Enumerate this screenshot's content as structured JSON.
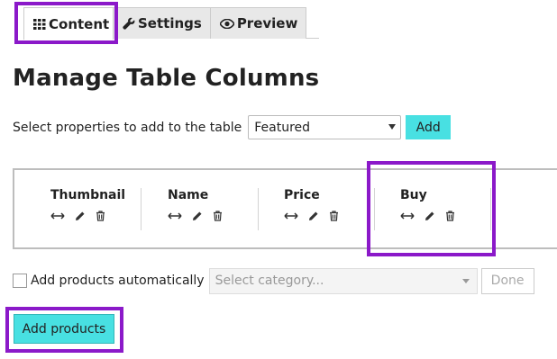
{
  "tabs": [
    {
      "label": "Content",
      "icon": "grid-icon",
      "active": true
    },
    {
      "label": "Settings",
      "icon": "wrench-icon",
      "active": false
    },
    {
      "label": "Preview",
      "icon": "eye-icon",
      "active": false
    }
  ],
  "page_title": "Manage Table Columns",
  "properties": {
    "label": "Select properties to add to the table",
    "selected": "Featured",
    "add_label": "Add"
  },
  "columns": [
    {
      "title": "Thumbnail",
      "icons": [
        "resize-icon",
        "pencil-icon",
        "trash-icon"
      ]
    },
    {
      "title": "Name",
      "icons": [
        "resize-icon",
        "pencil-icon",
        "trash-icon"
      ]
    },
    {
      "title": "Price",
      "icons": [
        "resize-icon",
        "pencil-icon",
        "trash-icon"
      ]
    },
    {
      "title": "Buy",
      "icons": [
        "resize-icon",
        "pencil-icon",
        "trash-icon"
      ]
    }
  ],
  "auto_add": {
    "label": "Add products automatically",
    "checked": false,
    "category_placeholder": "Select category...",
    "done_label": "Done"
  },
  "add_products_label": "Add products",
  "colors": {
    "highlight": "#8b19c9",
    "accent": "#48e0e2"
  }
}
